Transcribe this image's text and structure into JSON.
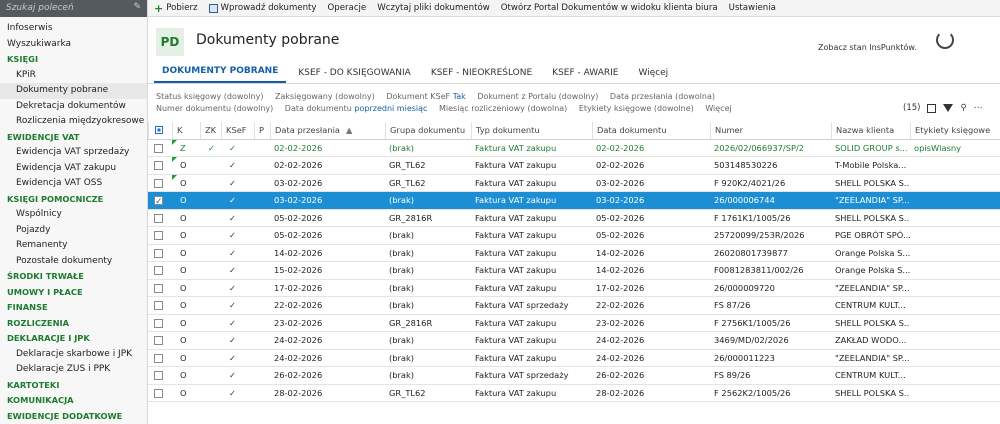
{
  "sidebar": {
    "search_placeholder": "Szukaj poleceń",
    "items": [
      {
        "label": "Infoserwis",
        "kind": "top"
      },
      {
        "label": "Wyszukiwarka",
        "kind": "top"
      },
      {
        "label": "KSIĘGI",
        "kind": "sec"
      },
      {
        "label": "KPiR",
        "kind": "sub"
      },
      {
        "label": "Dokumenty pobrane",
        "kind": "sub",
        "active": true
      },
      {
        "label": "Dekretacja dokumentów",
        "kind": "sub"
      },
      {
        "label": "Rozliczenia międzyokresowe",
        "kind": "sub"
      },
      {
        "label": "EWIDENCJE VAT",
        "kind": "sec"
      },
      {
        "label": "Ewidencja VAT sprzedaży",
        "kind": "sub"
      },
      {
        "label": "Ewidencja VAT zakupu",
        "kind": "sub"
      },
      {
        "label": "Ewidencja VAT OSS",
        "kind": "sub"
      },
      {
        "label": "KSIĘGI POMOCNICZE",
        "kind": "sec"
      },
      {
        "label": "Wspólnicy",
        "kind": "sub"
      },
      {
        "label": "Pojazdy",
        "kind": "sub"
      },
      {
        "label": "Remanenty",
        "kind": "sub"
      },
      {
        "label": "Pozostałe dokumenty",
        "kind": "sub"
      },
      {
        "label": "ŚRODKI TRWAŁE",
        "kind": "sec"
      },
      {
        "label": "UMOWY I PŁACE",
        "kind": "sec"
      },
      {
        "label": "FINANSE",
        "kind": "sec"
      },
      {
        "label": "ROZLICZENIA",
        "kind": "sec"
      },
      {
        "label": "DEKLARACJE I JPK",
        "kind": "sec"
      },
      {
        "label": "Deklaracje skarbowe i JPK",
        "kind": "sub"
      },
      {
        "label": "Deklaracje ZUS i PPK",
        "kind": "sub"
      },
      {
        "label": "KARTOTEKI",
        "kind": "sec"
      },
      {
        "label": "KOMUNIKACJA",
        "kind": "sec"
      },
      {
        "label": "EWIDENCJE DODATKOWE",
        "kind": "sec"
      }
    ]
  },
  "toolbar": {
    "pobierz": "Pobierz",
    "wprowadz": "Wprowadź dokumenty",
    "operacje": "Operacje",
    "wczytaj": "Wczytaj pliki dokumentów",
    "otworz": "Otwórz Portal Dokumentów w widoku klienta biura",
    "ustawienia": "Ustawienia"
  },
  "header": {
    "badge": "PD",
    "title": "Dokumenty pobrane",
    "insp": "Zobacz stan InsPunktów."
  },
  "tabs": [
    "DOKUMENTY POBRANE",
    "KSEF - DO KSIĘGOWANIA",
    "KSEF - NIEOKREŚLONE",
    "KSEF - AWARIE",
    "Więcej"
  ],
  "filters": {
    "row1": [
      "Status księgowy (dowolny)",
      "Zaksięgowany (dowolny)",
      "Dokument KSeF",
      "Dokument z Portalu (dowolny)",
      "Data przesłania (dowolna)"
    ],
    "ksef_value": "Tak",
    "row2": [
      "Numer dokumentu (dowolny)",
      "Data dokumentu",
      "Miesiąc rozliczeniowy (dowolna)",
      "Etykiety księgowe (dowolne)",
      "Więcej"
    ],
    "data_dok_value": "poprzedni miesiąc",
    "count": "(15)"
  },
  "columns": [
    "K",
    "ZK",
    "KSeF",
    "P",
    "Data przesłania",
    "Grupa dokumentu",
    "Typ dokumentu",
    "Data dokumentu",
    "Numer",
    "Nazwa klienta",
    "Etykiety księgowe"
  ],
  "rows": [
    {
      "k": "Z",
      "zk": "✓",
      "ksef": "✓",
      "data_p": "02-02-2026",
      "grupa": "(brak)",
      "typ": "Faktura VAT zakupu",
      "data_d": "02-02-2026",
      "numer": "2026/02/066937/SP/2",
      "klient": "SOLID GROUP s...",
      "etykiety": "opisWlasny",
      "green": true,
      "tri": true
    },
    {
      "k": "O",
      "zk": "",
      "ksef": "✓",
      "data_p": "02-02-2026",
      "grupa": "GR_TL62",
      "typ": "Faktura VAT zakupu",
      "data_d": "02-02-2026",
      "numer": "503148530226",
      "klient": "T-Mobile Polska...",
      "etykiety": "",
      "tri": true
    },
    {
      "k": "O",
      "zk": "",
      "ksef": "✓",
      "data_p": "03-02-2026",
      "grupa": "GR_TL62",
      "typ": "Faktura VAT zakupu",
      "data_d": "03-02-2026",
      "numer": "F 920K2/4021/26",
      "klient": "SHELL POLSKA S...",
      "etykiety": "",
      "tri": true
    },
    {
      "k": "O",
      "zk": "",
      "ksef": "✓",
      "data_p": "03-02-2026",
      "grupa": "(brak)",
      "typ": "Faktura VAT zakupu",
      "data_d": "03-02-2026",
      "numer": "26/000006744",
      "klient": "\"ZEELANDIA\" SP...",
      "etykiety": "",
      "selected": true
    },
    {
      "k": "O",
      "zk": "",
      "ksef": "✓",
      "data_p": "05-02-2026",
      "grupa": "GR_2816R",
      "typ": "Faktura VAT zakupu",
      "data_d": "05-02-2026",
      "numer": "F 1761K1/1005/26",
      "klient": "SHELL POLSKA S...",
      "etykiety": ""
    },
    {
      "k": "O",
      "zk": "",
      "ksef": "✓",
      "data_p": "05-02-2026",
      "grupa": "(brak)",
      "typ": "Faktura VAT zakupu",
      "data_d": "05-02-2026",
      "numer": "25720099/253R/2026",
      "klient": "PGE OBRÓT SPÓ...",
      "etykiety": ""
    },
    {
      "k": "O",
      "zk": "",
      "ksef": "✓",
      "data_p": "14-02-2026",
      "grupa": "(brak)",
      "typ": "Faktura VAT zakupu",
      "data_d": "14-02-2026",
      "numer": "26020801739877",
      "klient": "Orange Polska S...",
      "etykiety": ""
    },
    {
      "k": "O",
      "zk": "",
      "ksef": "✓",
      "data_p": "15-02-2026",
      "grupa": "(brak)",
      "typ": "Faktura VAT zakupu",
      "data_d": "14-02-2026",
      "numer": "F0081283811/002/26",
      "klient": "Orange Polska S...",
      "etykiety": ""
    },
    {
      "k": "O",
      "zk": "",
      "ksef": "✓",
      "data_p": "17-02-2026",
      "grupa": "(brak)",
      "typ": "Faktura VAT zakupu",
      "data_d": "17-02-2026",
      "numer": "26/000009720",
      "klient": "\"ZEELANDIA\" SP...",
      "etykiety": ""
    },
    {
      "k": "O",
      "zk": "",
      "ksef": "✓",
      "data_p": "22-02-2026",
      "grupa": "(brak)",
      "typ": "Faktura VAT sprzedaży",
      "data_d": "22-02-2026",
      "numer": "FS 87/26",
      "klient": "CENTRUM KULT...",
      "etykiety": ""
    },
    {
      "k": "O",
      "zk": "",
      "ksef": "✓",
      "data_p": "23-02-2026",
      "grupa": "GR_2816R",
      "typ": "Faktura VAT zakupu",
      "data_d": "23-02-2026",
      "numer": "F 2756K1/1005/26",
      "klient": "SHELL POLSKA S...",
      "etykiety": ""
    },
    {
      "k": "O",
      "zk": "",
      "ksef": "✓",
      "data_p": "24-02-2026",
      "grupa": "(brak)",
      "typ": "Faktura VAT zakupu",
      "data_d": "24-02-2026",
      "numer": "3469/MD/02/2026",
      "klient": "ZAKŁAD WODO...",
      "etykiety": ""
    },
    {
      "k": "O",
      "zk": "",
      "ksef": "✓",
      "data_p": "24-02-2026",
      "grupa": "(brak)",
      "typ": "Faktura VAT zakupu",
      "data_d": "24-02-2026",
      "numer": "26/000011223",
      "klient": "\"ZEELANDIA\" SP...",
      "etykiety": ""
    },
    {
      "k": "O",
      "zk": "",
      "ksef": "✓",
      "data_p": "26-02-2026",
      "grupa": "(brak)",
      "typ": "Faktura VAT sprzedaży",
      "data_d": "26-02-2026",
      "numer": "FS 89/26",
      "klient": "CENTRUM KULT...",
      "etykiety": ""
    },
    {
      "k": "O",
      "zk": "",
      "ksef": "✓",
      "data_p": "28-02-2026",
      "grupa": "GR_TL62",
      "typ": "Faktura VAT zakupu",
      "data_d": "28-02-2026",
      "numer": "F 2562K2/1005/26",
      "klient": "SHELL POLSKA S...",
      "etykiety": ""
    }
  ]
}
